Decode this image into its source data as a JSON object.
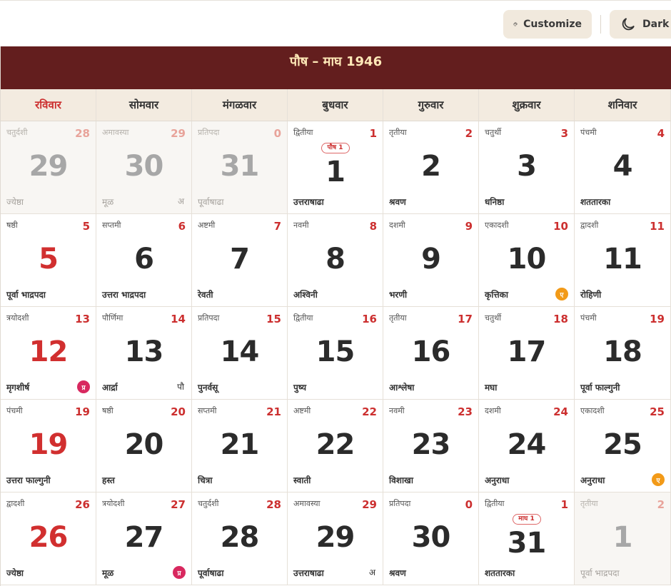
{
  "toolbar": {
    "customize_label": "Customize",
    "dark_label": "Dark"
  },
  "calendar": {
    "title": "पौष – माघ 1946",
    "weekdays": [
      "रविवार",
      "सोमवार",
      "मंगळवार",
      "बुधवार",
      "गुरुवार",
      "शुक्रवार",
      "शनिवार"
    ],
    "cells": [
      {
        "tithi": "चतुर्दशी",
        "tnum": "28",
        "date": "29",
        "nak": "ज्येष्ठा",
        "mark": "",
        "circle": "",
        "badge": "",
        "other": true
      },
      {
        "tithi": "अमावस्या",
        "tnum": "29",
        "date": "30",
        "nak": "मूळ",
        "mark": "अ",
        "circle": "",
        "badge": "",
        "other": true
      },
      {
        "tithi": "प्रतिपदा",
        "tnum": "0",
        "date": "31",
        "nak": "पूर्वाषाढा",
        "mark": "",
        "circle": "",
        "badge": "",
        "other": true
      },
      {
        "tithi": "द्वितीया",
        "tnum": "1",
        "date": "1",
        "nak": "उत्तराषाढा",
        "mark": "",
        "circle": "",
        "badge": "पौष 1",
        "other": false
      },
      {
        "tithi": "तृतीया",
        "tnum": "2",
        "date": "2",
        "nak": "श्रवण",
        "mark": "",
        "circle": "",
        "badge": "",
        "other": false
      },
      {
        "tithi": "चतुर्थी",
        "tnum": "3",
        "date": "3",
        "nak": "धनिष्ठा",
        "mark": "",
        "circle": "",
        "badge": "",
        "other": false
      },
      {
        "tithi": "पंचमी",
        "tnum": "4",
        "date": "4",
        "nak": "शततारका",
        "mark": "",
        "circle": "",
        "badge": "",
        "other": false
      },
      {
        "tithi": "षष्ठी",
        "tnum": "5",
        "date": "5",
        "nak": "पूर्वा भाद्रपदा",
        "mark": "",
        "circle": "",
        "badge": "",
        "other": false
      },
      {
        "tithi": "सप्तमी",
        "tnum": "6",
        "date": "6",
        "nak": "उत्तरा भाद्रपदा",
        "mark": "",
        "circle": "",
        "badge": "",
        "other": false
      },
      {
        "tithi": "अष्टमी",
        "tnum": "7",
        "date": "7",
        "nak": "रेवती",
        "mark": "",
        "circle": "",
        "badge": "",
        "other": false
      },
      {
        "tithi": "नवमी",
        "tnum": "8",
        "date": "8",
        "nak": "अश्विनी",
        "mark": "",
        "circle": "",
        "badge": "",
        "other": false
      },
      {
        "tithi": "दशमी",
        "tnum": "9",
        "date": "9",
        "nak": "भरणी",
        "mark": "",
        "circle": "",
        "badge": "",
        "other": false
      },
      {
        "tithi": "एकादशी",
        "tnum": "10",
        "date": "10",
        "nak": "कृत्तिका",
        "mark": "",
        "circle": "ए",
        "badge": "",
        "other": false
      },
      {
        "tithi": "द्वादशी",
        "tnum": "11",
        "date": "11",
        "nak": "रोहिणी",
        "mark": "",
        "circle": "",
        "badge": "",
        "other": false
      },
      {
        "tithi": "त्रयोदशी",
        "tnum": "13",
        "date": "12",
        "nak": "मृगशीर्ष",
        "mark": "",
        "circle": "प्र",
        "badge": "",
        "other": false
      },
      {
        "tithi": "पौर्णिमा",
        "tnum": "14",
        "date": "13",
        "nak": "आर्द्रा",
        "mark": "पौ",
        "circle": "",
        "badge": "",
        "other": false
      },
      {
        "tithi": "प्रतिपदा",
        "tnum": "15",
        "date": "14",
        "nak": "पुनर्वसू",
        "mark": "",
        "circle": "",
        "badge": "",
        "other": false
      },
      {
        "tithi": "द्वितीया",
        "tnum": "16",
        "date": "15",
        "nak": "पुष्य",
        "mark": "",
        "circle": "",
        "badge": "",
        "other": false
      },
      {
        "tithi": "तृतीया",
        "tnum": "17",
        "date": "16",
        "nak": "आश्लेषा",
        "mark": "",
        "circle": "",
        "badge": "",
        "other": false
      },
      {
        "tithi": "चतुर्थी",
        "tnum": "18",
        "date": "17",
        "nak": "मघा",
        "mark": "",
        "circle": "",
        "badge": "",
        "other": false
      },
      {
        "tithi": "पंचमी",
        "tnum": "19",
        "date": "18",
        "nak": "पूर्वा फाल्गुनी",
        "mark": "",
        "circle": "",
        "badge": "",
        "other": false
      },
      {
        "tithi": "पंचमी",
        "tnum": "19",
        "date": "19",
        "nak": "उत्तरा फाल्गुनी",
        "mark": "",
        "circle": "",
        "badge": "",
        "other": false
      },
      {
        "tithi": "षष्ठी",
        "tnum": "20",
        "date": "20",
        "nak": "हस्त",
        "mark": "",
        "circle": "",
        "badge": "",
        "other": false
      },
      {
        "tithi": "सप्तमी",
        "tnum": "21",
        "date": "21",
        "nak": "चित्रा",
        "mark": "",
        "circle": "",
        "badge": "",
        "other": false
      },
      {
        "tithi": "अष्टमी",
        "tnum": "22",
        "date": "22",
        "nak": "स्वाती",
        "mark": "",
        "circle": "",
        "badge": "",
        "other": false
      },
      {
        "tithi": "नवमी",
        "tnum": "23",
        "date": "23",
        "nak": "विशाखा",
        "mark": "",
        "circle": "",
        "badge": "",
        "other": false
      },
      {
        "tithi": "दशमी",
        "tnum": "24",
        "date": "24",
        "nak": "अनुराधा",
        "mark": "",
        "circle": "",
        "badge": "",
        "other": false
      },
      {
        "tithi": "एकादशी",
        "tnum": "25",
        "date": "25",
        "nak": "अनुराधा",
        "mark": "",
        "circle": "ए",
        "badge": "",
        "other": false
      },
      {
        "tithi": "द्वादशी",
        "tnum": "26",
        "date": "26",
        "nak": "ज्येष्ठा",
        "mark": "",
        "circle": "",
        "badge": "",
        "other": false
      },
      {
        "tithi": "त्रयोदशी",
        "tnum": "27",
        "date": "27",
        "nak": "मूळ",
        "mark": "",
        "circle": "प्र",
        "badge": "",
        "other": false
      },
      {
        "tithi": "चतुर्दशी",
        "tnum": "28",
        "date": "28",
        "nak": "पूर्वाषाढा",
        "mark": "",
        "circle": "",
        "badge": "",
        "other": false
      },
      {
        "tithi": "अमावस्या",
        "tnum": "29",
        "date": "29",
        "nak": "उत्तराषाढा",
        "mark": "अ",
        "circle": "",
        "badge": "",
        "other": false
      },
      {
        "tithi": "प्रतिपदा",
        "tnum": "0",
        "date": "30",
        "nak": "श्रवण",
        "mark": "",
        "circle": "",
        "badge": "",
        "other": false
      },
      {
        "tithi": "द्वितीया",
        "tnum": "1",
        "date": "31",
        "nak": "शततारका",
        "mark": "",
        "circle": "",
        "badge": "माघ 1",
        "other": false
      },
      {
        "tithi": "तृतीया",
        "tnum": "2",
        "date": "1",
        "nak": "पूर्वा भाद्रपदा",
        "mark": "",
        "circle": "",
        "badge": "",
        "other": true
      }
    ]
  }
}
